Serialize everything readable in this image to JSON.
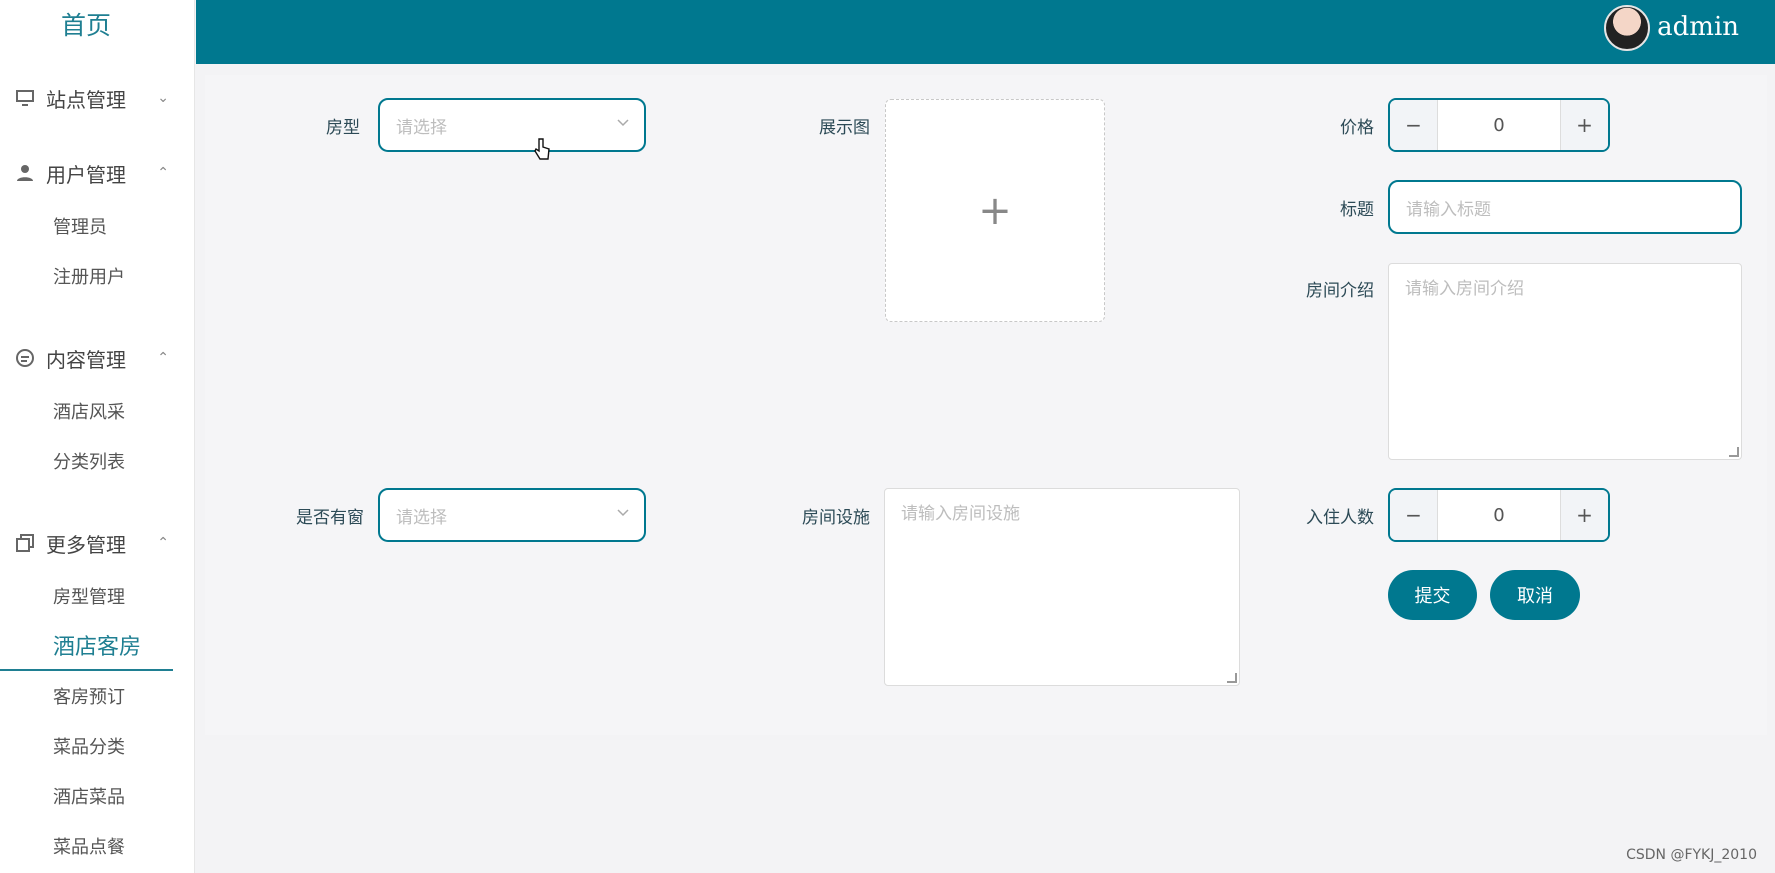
{
  "sidebar": {
    "home": "首页",
    "groups": [
      {
        "label": "站点管理",
        "icon": "monitor-icon",
        "caret": "⌄",
        "items": []
      },
      {
        "label": "用户管理",
        "icon": "user-icon",
        "caret": "⌃",
        "items": [
          "管理员",
          "注册用户"
        ]
      },
      {
        "label": "内容管理",
        "icon": "chat-icon",
        "caret": "⌃",
        "items": [
          "酒店风采",
          "分类列表"
        ]
      },
      {
        "label": "更多管理",
        "icon": "copy-icon",
        "caret": "⌃",
        "items": [
          "房型管理",
          "酒店客房",
          "客房预订",
          "菜品分类",
          "酒店菜品",
          "菜品点餐"
        ]
      }
    ]
  },
  "topbar": {
    "username": "admin"
  },
  "form": {
    "room_type_label": "房型",
    "room_type_placeholder": "请选择",
    "display_image_label": "展示图",
    "upload_plus": "+",
    "price_label": "价格",
    "price_value": "0",
    "title_label": "标题",
    "title_placeholder": "请输入标题",
    "intro_label": "房间介绍",
    "intro_placeholder": "请输入房间介绍",
    "window_label": "是否有窗",
    "window_placeholder": "请选择",
    "facilities_label": "房间设施",
    "facilities_placeholder": "请输入房间设施",
    "occupancy_label": "入住人数",
    "occupancy_value": "0",
    "minus": "−",
    "plus": "+",
    "submit": "提交",
    "cancel": "取消"
  },
  "watermark": "CSDN @FYKJ_2010",
  "colors": {
    "accent": "#00788f",
    "background": "#f3f3f5"
  }
}
